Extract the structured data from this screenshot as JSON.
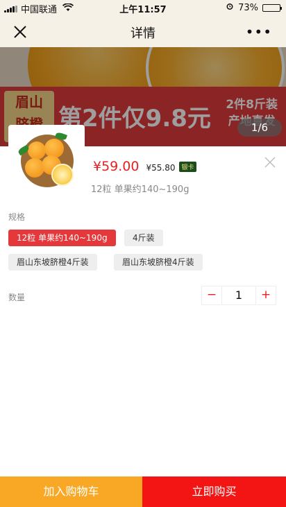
{
  "status_bar": {
    "carrier": "中国联通",
    "time": "上午11:57",
    "battery_percent": "73%",
    "battery_level": 0.73,
    "icons": [
      "signal-icon",
      "wifi-icon",
      "alarm-icon",
      "battery-icon"
    ]
  },
  "nav": {
    "title": "详情",
    "close_icon": "close-icon",
    "more_label": "•••"
  },
  "banner": {
    "label_line1": "眉山",
    "label_line2": "脐橙",
    "promo": "第2件仅9.8元",
    "side_line1": "2件8斤装",
    "side_line2": "产地直发",
    "page_counter": "1/6"
  },
  "product": {
    "price": "¥59.00",
    "member_price": "¥55.80",
    "member_badge": "银卡",
    "selected_spec": "12粒 单果约140~190g"
  },
  "spec": {
    "label": "规格",
    "options": [
      {
        "label": "12粒 单果约140~190g",
        "selected": true
      },
      {
        "label": "4斤装",
        "selected": false
      },
      {
        "label": "眉山东坡脐橙4斤装",
        "selected": false
      },
      {
        "label": "眉山东坡脐橙4斤装",
        "selected": false
      }
    ]
  },
  "quantity": {
    "label": "数量",
    "minus": "−",
    "value": "1",
    "plus": "+"
  },
  "actions": {
    "add_to_cart": "加入购物车",
    "buy_now": "立即购买"
  },
  "colors": {
    "accent_red": "#e82020",
    "cart_orange": "#f9a825",
    "buy_red": "#f31414",
    "chip_active": "#e5383b"
  }
}
